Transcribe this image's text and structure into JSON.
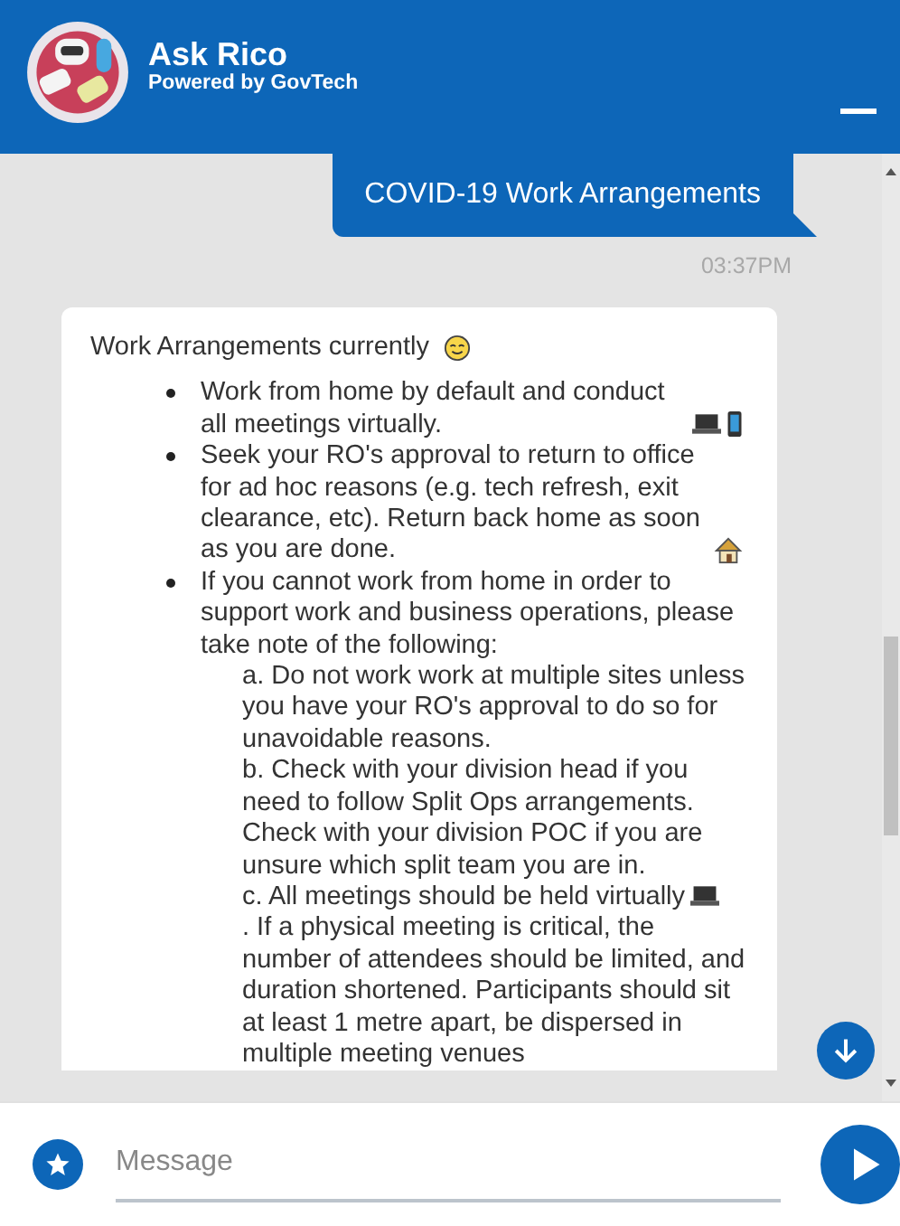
{
  "header": {
    "title": "Ask Rico",
    "subtitle": "Powered by GovTech"
  },
  "user_message": {
    "text": "COVID-19 Work Arrangements",
    "time": "03:37PM"
  },
  "bot_message": {
    "title": "Work Arrangements currently",
    "items": [
      {
        "kind": "bullet",
        "parts": [
          {
            "kind": "text",
            "text": "Work from home by default and conduct all meetings virtually."
          },
          {
            "kind": "laptop"
          },
          {
            "kind": "phone"
          }
        ]
      },
      {
        "kind": "bullet",
        "parts": [
          {
            "kind": "text",
            "text": "Seek your RO's approval to return to office for ad hoc reasons (e.g. tech refresh, exit clearance, etc). Return back home as soon as you are done."
          },
          {
            "kind": "house"
          }
        ]
      },
      {
        "kind": "bullet",
        "parts": [
          {
            "kind": "text",
            "text": "If you cannot work from home in order to support work and business operations, please take note of the following:"
          }
        ]
      },
      {
        "kind": "sub",
        "parts": [
          {
            "kind": "text",
            "text": "a. Do not work work at multiple sites unless you have your RO's approval to do so for unavoidable reasons."
          }
        ]
      },
      {
        "kind": "sub",
        "parts": [
          {
            "kind": "text",
            "text": "b. Check with your division head if you need to follow Split Ops arrangements. Check with your division POC if you are unsure which split team you are in."
          }
        ]
      },
      {
        "kind": "sub",
        "parts": [
          {
            "kind": "text",
            "text": "c. All meetings should be held virtually"
          },
          {
            "kind": "laptop"
          },
          {
            "kind": "text",
            "text": ". If a physical meeting is critical, the number of attendees should be limited, and duration shortened. Participants should sit at least 1 metre apart, be dispersed in multiple meeting venues"
          }
        ]
      }
    ]
  },
  "composer": {
    "placeholder": "Message"
  }
}
